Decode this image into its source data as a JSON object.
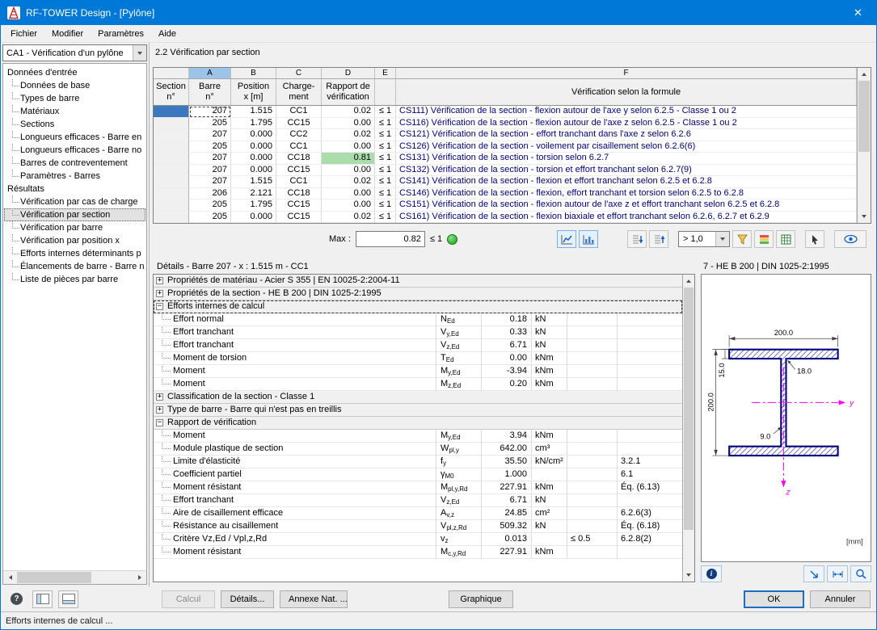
{
  "window": {
    "title": "RF-TOWER Design - [Pylône]"
  },
  "icons": {
    "close": "✕",
    "expand": "+",
    "collapse": "−",
    "help": "?",
    "info": "i"
  },
  "menu": {
    "items": [
      "Fichier",
      "Modifier",
      "Paramètres",
      "Aide"
    ]
  },
  "navigator": {
    "case_selector": "CA1 - Vérification d'un pylône",
    "groups": [
      {
        "label": "Données d'entrée",
        "items": [
          {
            "label": "Données de base"
          },
          {
            "label": "Types de barre"
          },
          {
            "label": "Matériaux"
          },
          {
            "label": "Sections"
          },
          {
            "label": "Longueurs efficaces - Barre en"
          },
          {
            "label": "Longueurs efficaces - Barre no"
          },
          {
            "label": "Barres de contreventement"
          },
          {
            "label": "Paramètres - Barres"
          }
        ]
      },
      {
        "label": "Résultats",
        "items": [
          {
            "label": "Vérification par cas de charge"
          },
          {
            "label": "Vérification par section",
            "selected": true
          },
          {
            "label": "Vérification par barre"
          },
          {
            "label": "Vérification par position x"
          },
          {
            "label": "Efforts internes déterminants p"
          },
          {
            "label": "Élancements de barre - Barre n"
          },
          {
            "label": "Liste de pièces par barre"
          }
        ]
      }
    ]
  },
  "results": {
    "title": "2.2 Vérification par section",
    "col_letters": [
      "A",
      "B",
      "C",
      "D",
      "E",
      "F"
    ],
    "header": {
      "section": [
        "Section",
        "n°"
      ],
      "barre": [
        "Barre",
        "n°"
      ],
      "position": [
        "Position",
        "x [m]"
      ],
      "chargement": [
        "Charge-",
        "ment"
      ],
      "rapport": [
        "Rapport de",
        "vérification"
      ],
      "formule": "Vérification selon la formule"
    },
    "rows": [
      {
        "barre": "207",
        "position": "1.515",
        "cc": "CC1",
        "ratio": "0.02",
        "leq": "≤ 1",
        "formula": "CS111) Vérification de la section - flexion autour de l'axe y selon 6.2.5 - Classe 1 ou 2",
        "selected": true
      },
      {
        "barre": "205",
        "position": "1.795",
        "cc": "CC15",
        "ratio": "0.00",
        "leq": "≤ 1",
        "formula": "CS116) Vérification de la section - flexion autour de l'axe z selon 6.2.5 - Classe 1 ou 2"
      },
      {
        "barre": "207",
        "position": "0.000",
        "cc": "CC2",
        "ratio": "0.02",
        "leq": "≤ 1",
        "formula": "CS121) Vérification de la section - effort tranchant dans l'axe z selon 6.2.6"
      },
      {
        "barre": "205",
        "position": "0.000",
        "cc": "CC1",
        "ratio": "0.00",
        "leq": "≤ 1",
        "formula": "CS126) Vérification de la section - voilement par cisaillement selon 6.2.6(6)"
      },
      {
        "barre": "207",
        "position": "0.000",
        "cc": "CC18",
        "ratio": "0.81",
        "leq": "≤ 1",
        "formula": "CS131) Vérification de la section - torsion selon 6.2.7",
        "highlight": true
      },
      {
        "barre": "207",
        "position": "0.000",
        "cc": "CC15",
        "ratio": "0.00",
        "leq": "≤ 1",
        "formula": "CS132) Vérification de la section - torsion et effort tranchant selon 6.2.7(9)"
      },
      {
        "barre": "207",
        "position": "1.515",
        "cc": "CC1",
        "ratio": "0.02",
        "leq": "≤ 1",
        "formula": "CS141) Vérification de la section - flexion et effort tranchant selon 6.2.5 et 6.2.8"
      },
      {
        "barre": "206",
        "position": "2.121",
        "cc": "CC18",
        "ratio": "0.00",
        "leq": "≤ 1",
        "formula": "CS146) Vérification de la section - flexion, effort tranchant et torsion selon 6.2.5 to 6.2.8"
      },
      {
        "barre": "205",
        "position": "1.795",
        "cc": "CC15",
        "ratio": "0.00",
        "leq": "≤ 1",
        "formula": "CS151) Vérification de la section - flexion autour de l'axe z et effort tranchant selon 6.2.5 et 6.2.8"
      },
      {
        "barre": "205",
        "position": "0.000",
        "cc": "CC15",
        "ratio": "0.02",
        "leq": "≤ 1",
        "formula": "CS161) Vérification de la section - flexion biaxiale et effort tranchant selon 6.2.6, 6.2.7 et 6.2.9"
      }
    ],
    "max_label": "Max :",
    "max_value": "0.82",
    "max_limit": "≤ 1",
    "filter_value": "> 1,0"
  },
  "details": {
    "title": "Détails - Barre 207 - x : 1.515 m - CC1",
    "rows": [
      {
        "type": "group",
        "expanded": false,
        "label": "Propriétés de matériau - Acier S 355 | EN 10025-2:2004-11"
      },
      {
        "type": "group",
        "expanded": false,
        "label": "Propriétés de la section - HE B 200 | DIN 1025-2:1995"
      },
      {
        "type": "group",
        "expanded": true,
        "focused": true,
        "label": "Efforts internes de calcul"
      },
      {
        "type": "item",
        "label": "Effort normal",
        "sym": "N",
        "sub": "Ed",
        "value": "0.18",
        "unit": "kN"
      },
      {
        "type": "item",
        "label": "Effort tranchant",
        "sym": "V",
        "sub": "y,Ed",
        "value": "0.33",
        "unit": "kN"
      },
      {
        "type": "item",
        "label": "Effort tranchant",
        "sym": "V",
        "sub": "z,Ed",
        "value": "6.71",
        "unit": "kN"
      },
      {
        "type": "item",
        "label": "Moment de torsion",
        "sym": "T",
        "sub": "Ed",
        "value": "0.00",
        "unit": "kNm"
      },
      {
        "type": "item",
        "label": "Moment",
        "sym": "M",
        "sub": "y,Ed",
        "value": "-3.94",
        "unit": "kNm"
      },
      {
        "type": "item",
        "label": "Moment",
        "sym": "M",
        "sub": "z,Ed",
        "value": "0.20",
        "unit": "kNm"
      },
      {
        "type": "group",
        "expanded": false,
        "label": "Classification de la section - Classe 1"
      },
      {
        "type": "group",
        "expanded": false,
        "label": "Type de barre - Barre qui n'est pas en treillis"
      },
      {
        "type": "group",
        "expanded": true,
        "label": "Rapport de vérification"
      },
      {
        "type": "item",
        "label": "Moment",
        "sym": "M",
        "sub": "y,Ed",
        "value": "3.94",
        "unit": "kNm"
      },
      {
        "type": "item",
        "label": "Module plastique de section",
        "sym": "W",
        "sub": "pl,y",
        "value": "642.00",
        "unit": "cm³"
      },
      {
        "type": "item",
        "label": "Limite d'élasticité",
        "sym": "f",
        "sub": "y",
        "value": "35.50",
        "unit": "kN/cm²",
        "ref": "3.2.1"
      },
      {
        "type": "item",
        "label": "Coefficient partiel",
        "sym": "γ",
        "sub": "M0",
        "value": "1.000",
        "unit": "",
        "ref": "6.1"
      },
      {
        "type": "item",
        "label": "Moment résistant",
        "sym": "M",
        "sub": "pl,y,Rd",
        "value": "227.91",
        "unit": "kNm",
        "ref": "Éq. (6.13)"
      },
      {
        "type": "item",
        "label": "Effort tranchant",
        "sym": "V",
        "sub": "z,Ed",
        "value": "6.71",
        "unit": "kN"
      },
      {
        "type": "item",
        "label": "Aire de cisaillement efficace",
        "sym": "A",
        "sub": "v,z",
        "value": "24.85",
        "unit": "cm²",
        "ref": "6.2.6(3)"
      },
      {
        "type": "item",
        "label": "Résistance au cisaillement",
        "sym": "V",
        "sub": "pl,z,Rd",
        "value": "509.32",
        "unit": "kN",
        "ref": "Éq. (6.18)"
      },
      {
        "type": "item",
        "label": "Critère Vz,Ed / Vpl,z,Rd",
        "sym": "v",
        "sub": "z",
        "value": "0.013",
        "unit": "",
        "crit": "≤ 0.5",
        "ref": "6.2.8(2)"
      },
      {
        "type": "item",
        "label": "Moment résistant",
        "sym": "M",
        "sub": "c,y,Rd",
        "value": "227.91",
        "unit": "kNm"
      }
    ]
  },
  "section_panel": {
    "title": "7 - HE B 200 | DIN 1025-2:1995",
    "dims": {
      "width": "200.0",
      "height": "200.0",
      "flange_thickness": "15.0",
      "radius": "18.0",
      "web_thickness": "9.0"
    },
    "axis_y": "y",
    "axis_z": "z",
    "unit_label": "[mm]"
  },
  "footer": {
    "calcul": "Calcul",
    "details": "Détails...",
    "annexe": "Annexe Nat. ...",
    "graphique": "Graphique",
    "ok": "OK",
    "annuler": "Annuler"
  },
  "statusbar": {
    "text": "Efforts internes de calcul ..."
  }
}
